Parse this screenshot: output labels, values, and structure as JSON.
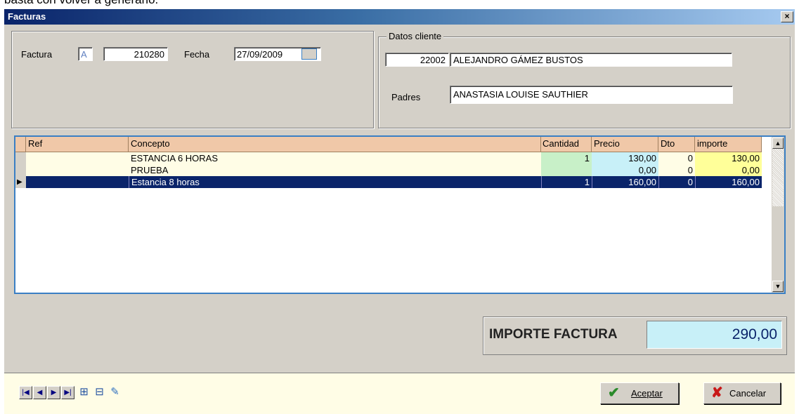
{
  "background_caption": "basta con volver a generarlo.",
  "window": {
    "title": "Facturas",
    "close": "×"
  },
  "invoice": {
    "factura_label": "Factura",
    "serie": "A",
    "number": "210280",
    "fecha_label": "Fecha",
    "fecha": "27/09/2009"
  },
  "client": {
    "group_label": "Datos cliente",
    "code": "22002",
    "name": "ALEJANDRO GÁMEZ BUSTOS",
    "padres_label": "Padres",
    "padres": "ANASTASIA LOUISE SAUTHIER"
  },
  "grid": {
    "columns": [
      "Ref",
      "Concepto",
      "Cantidad",
      "Precio",
      "Dto",
      "importe"
    ],
    "rows": [
      {
        "ref": "",
        "concepto": "ESTANCIA 6 HORAS",
        "cantidad": "1",
        "precio": "130,00",
        "dto": "0",
        "importe": "130,00",
        "selected": false
      },
      {
        "ref": "",
        "concepto": "PRUEBA",
        "cantidad": "",
        "precio": "0,00",
        "dto": "0",
        "importe": "0,00",
        "selected": false
      },
      {
        "ref": "",
        "concepto": "Estancia 8 horas",
        "cantidad": "1",
        "precio": "160,00",
        "dto": "0",
        "importe": "160,00",
        "selected": true
      }
    ]
  },
  "total": {
    "label": "IMPORTE FACTURA",
    "value": "290,00"
  },
  "buttons": {
    "aceptar": "Aceptar",
    "cancelar": "Cancelar"
  },
  "colors": {
    "accent": "#0a246a",
    "header": "#f0c8a8",
    "cantidad_bg": "#c8f0c8",
    "precio_bg": "#c8f0f8",
    "importe_bg": "#ffff99",
    "grid_border": "#3a7fc4",
    "total_bg": "#c8f0f8"
  },
  "icons": [
    "first-record-icon",
    "prev-record-icon",
    "next-record-icon",
    "last-record-icon",
    "insert-record-icon",
    "delete-record-icon",
    "edit-record-icon",
    "check-icon",
    "x-icon"
  ]
}
